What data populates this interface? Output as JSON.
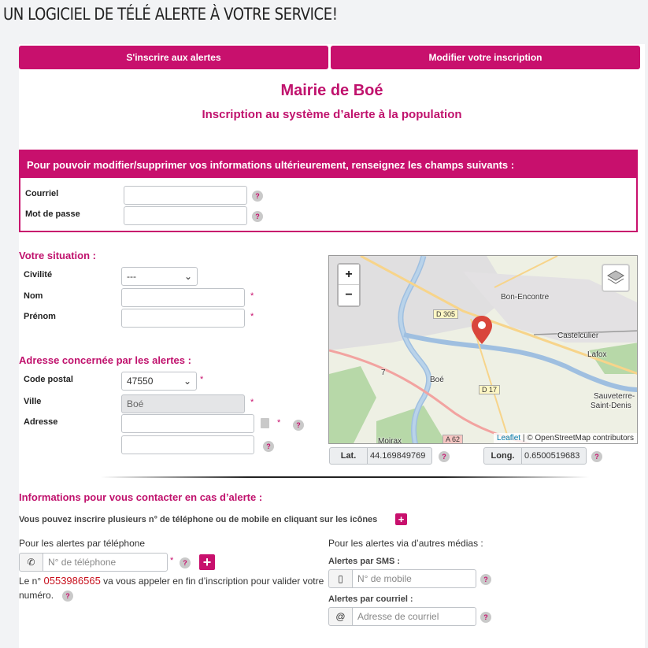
{
  "header": {
    "title": "UN LOGICIEL DE TÉLÉ ALERTE À VOTRE SERVICE!"
  },
  "tabs": {
    "subscribe": "S'inscrire aux alertes",
    "modify": "Modifier votre inscription"
  },
  "title": "Mairie de Boé",
  "subtitle": "Inscription au système d’alerte à la population",
  "account_box": {
    "heading": "Pour pouvoir modifier/supprimer vos informations ultérieurement, renseignez les champs suivants :",
    "email_label": "Courriel",
    "password_label": "Mot de passe"
  },
  "situation": {
    "heading": "Votre situation :",
    "civility_label": "Civilité",
    "civility_value": "---",
    "name_label": "Nom",
    "firstname_label": "Prénom"
  },
  "address": {
    "heading": "Adresse concernée par les alertes :",
    "postal_label": "Code postal",
    "postal_value": "47550",
    "city_label": "Ville",
    "city_value": "Boé",
    "address_label": "Adresse"
  },
  "map": {
    "zoom_in": "+",
    "zoom_out": "−",
    "labels": [
      "Bon-Encontre",
      "Castelculier",
      "Lafox",
      "Boé",
      "Sauveterre-",
      "Saint-Denis",
      "Moirax"
    ],
    "roads": [
      "D 305",
      "D 17",
      "A 62",
      "7"
    ],
    "attribution_link": "Leaflet",
    "attribution_text": "| © OpenStreetMap contributors"
  },
  "coords": {
    "lat_label": "Lat.",
    "lat_value": "44.169849769",
    "long_label": "Long.",
    "long_value": "0.6500519683"
  },
  "contact": {
    "heading": "Informations pour vous contacter en cas d’alerte :",
    "note": "Vous pouvez inscrire plusieurs n° de téléphone ou de mobile en cliquant sur les icônes",
    "phone_heading": "Pour les alertes par téléphone",
    "phone_placeholder": "N° de téléphone",
    "phone_note_pre": "Le n°",
    "phone_number": "0553986565",
    "phone_note_post": "va vous appeler en fin d’inscription pour valider votre numéro.",
    "other_heading": "Pour les alertes via d’autres médias :",
    "sms_label": "Alertes par SMS :",
    "sms_placeholder": "N° de mobile",
    "mail_label": "Alertes par courriel :",
    "mail_placeholder": "Adresse de courriel"
  },
  "help_symbol": "?",
  "required_symbol": "*",
  "plus_symbol": "+",
  "colors": {
    "accent": "#c8106d",
    "background": "#f2f3f5"
  }
}
